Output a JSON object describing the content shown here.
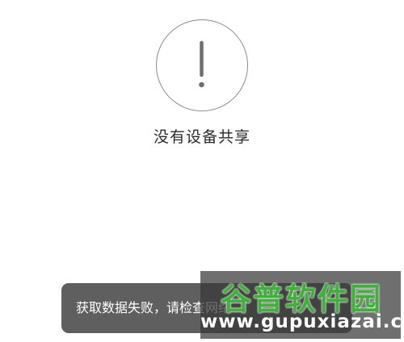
{
  "empty_state": {
    "icon": "exclamation-circle-icon",
    "message": "没有设备共享"
  },
  "toast": {
    "message": "获取数据失败，请检查网络"
  },
  "watermark": {
    "title": "谷普软件园",
    "url": "www.gupuxiazai.com"
  },
  "colors": {
    "background": "#ffffff",
    "icon_stroke": "#8a8a8a",
    "toast_background": "#5f5f5f",
    "watermark_green": "#3fb03a"
  }
}
